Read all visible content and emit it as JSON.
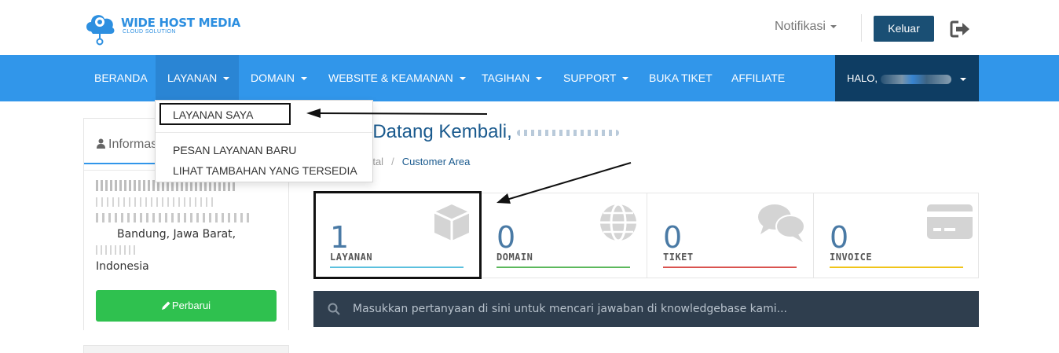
{
  "brand": {
    "title": "WIDE HOST MEDIA",
    "subtitle": "CLOUD SOLUTION",
    "color": "#2d8fe0"
  },
  "header": {
    "notifications_label": "Notifikasi",
    "logout_label": "Keluar"
  },
  "nav": {
    "items": [
      {
        "label": "BERANDA",
        "dropdown": false
      },
      {
        "label": "LAYANAN",
        "dropdown": true,
        "active": true
      },
      {
        "label": "DOMAIN",
        "dropdown": true
      },
      {
        "label": "WEBSITE & KEAMANAN",
        "dropdown": true
      },
      {
        "label": "TAGIHAN",
        "dropdown": true
      },
      {
        "label": "SUPPORT",
        "dropdown": true
      },
      {
        "label": "BUKA TIKET",
        "dropdown": false
      },
      {
        "label": "AFFILIATE",
        "dropdown": false
      }
    ],
    "user_greeting": "HALO,"
  },
  "dropdown": {
    "items": [
      "LAYANAN SAYA",
      "PESAN LAYANAN BARU",
      "LIHAT TAMBAHAN YANG TERSEDIA"
    ]
  },
  "sidebar": {
    "title": "Informas",
    "address_lines": [
      "Bandung, Jawa Barat,",
      "Indonesia"
    ],
    "update_button": "Perbarui"
  },
  "main": {
    "welcome": "t Datang Kembali,",
    "breadcrumb": [
      "rtal",
      "Customer Area"
    ]
  },
  "tiles": [
    {
      "count": "1",
      "label": "LAYANAN",
      "icon": "cube-icon",
      "color": "#5bc0de"
    },
    {
      "count": "0",
      "label": "DOMAIN",
      "icon": "globe-icon",
      "color": "#5cb85c"
    },
    {
      "count": "0",
      "label": "TIKET",
      "icon": "comments-icon",
      "color": "#d9534f"
    },
    {
      "count": "0",
      "label": "INVOICE",
      "icon": "credit-card-icon",
      "color": "#f0c419"
    }
  ],
  "kb_search": {
    "placeholder": "Masukkan pertanyaan di sini untuk mencari jawaban di knowledgebase kami..."
  }
}
